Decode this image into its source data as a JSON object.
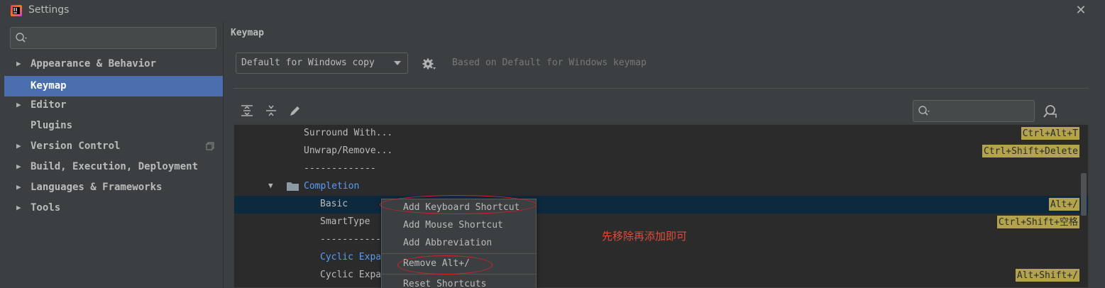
{
  "window": {
    "title": "Settings"
  },
  "sidebar": {
    "search_placeholder": "",
    "items": [
      {
        "label": "Appearance & Behavior",
        "expandable": true
      },
      {
        "label": "Keymap",
        "expandable": false,
        "selected": true
      },
      {
        "label": "Editor",
        "expandable": true
      },
      {
        "label": "Plugins",
        "expandable": false
      },
      {
        "label": "Version Control",
        "expandable": true
      },
      {
        "label": "Build, Execution, Deployment",
        "expandable": true
      },
      {
        "label": "Languages & Frameworks",
        "expandable": true
      },
      {
        "label": "Tools",
        "expandable": true
      }
    ]
  },
  "main": {
    "title": "Keymap",
    "keymap_select": "Default for Windows copy",
    "based_on": "Based on Default for Windows keymap",
    "filter_placeholder": ""
  },
  "actions": [
    {
      "label": "Surround With...",
      "shortcut": "Ctrl+Alt+T"
    },
    {
      "label": "Unwrap/Remove...",
      "shortcut": "Ctrl+Shift+Delete"
    },
    {
      "label": "-------------",
      "shortcut": ""
    },
    {
      "label": "Completion",
      "shortcut": ""
    },
    {
      "label": "Basic",
      "shortcut": "Alt+/"
    },
    {
      "label": "SmartType",
      "shortcut": "Ctrl+Shift+空格"
    },
    {
      "label": "-------------",
      "shortcut": ""
    },
    {
      "label": "Cyclic Expa",
      "shortcut": ""
    },
    {
      "label": "Cyclic Expa",
      "shortcut": "Alt+Shift+/"
    }
  ],
  "context_menu": {
    "items": [
      "Add Keyboard Shortcut",
      "Add Mouse Shortcut",
      "Add Abbreviation",
      "Remove Alt+/",
      "Reset Shortcuts"
    ]
  },
  "annotation": {
    "text": "先移除再添加即可",
    "color": "#d2232a"
  },
  "colors": {
    "selection": "#4b6eaf",
    "shortcut_badge": "#b3a34c",
    "link": "#589df6"
  }
}
